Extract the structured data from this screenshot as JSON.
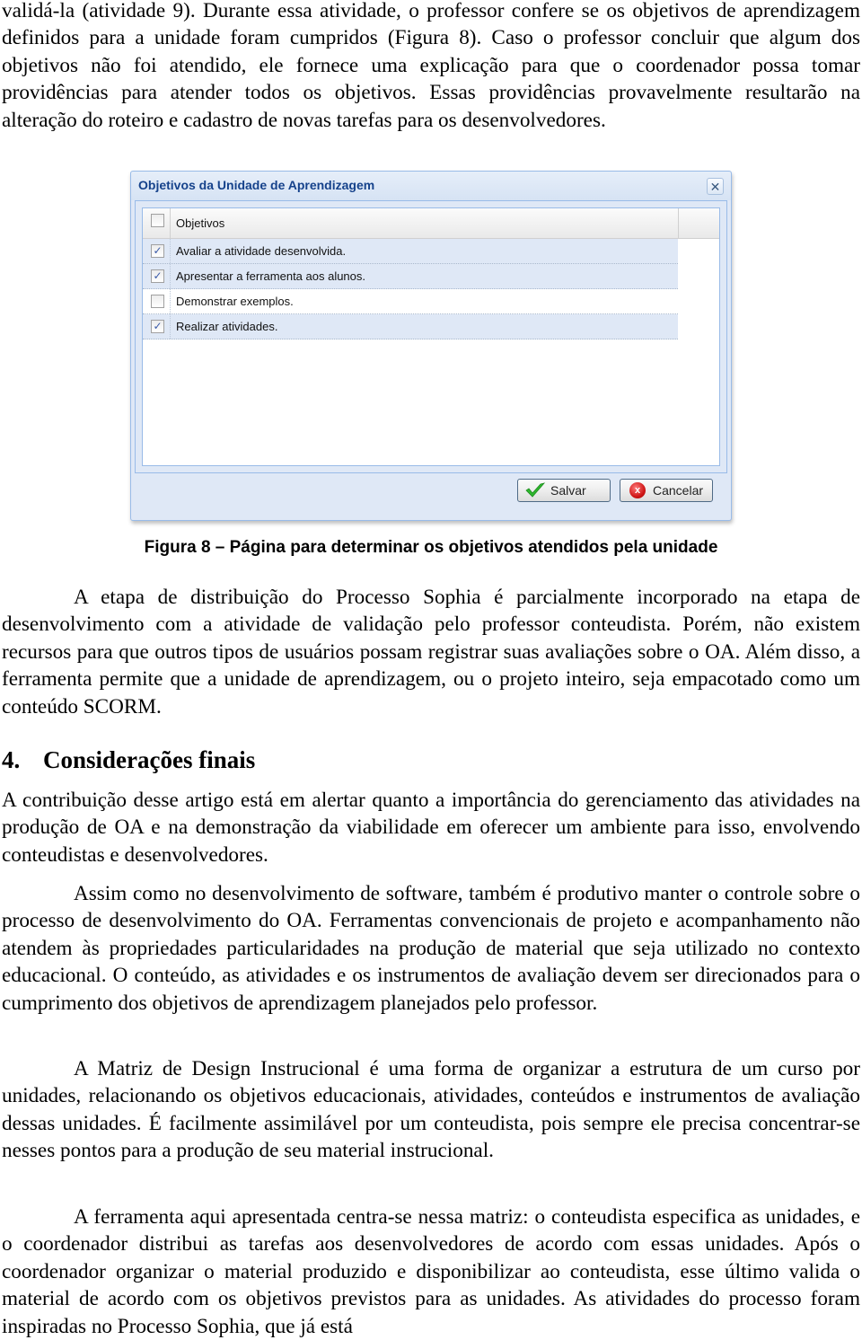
{
  "paragraphs_top": [
    "validá-la (atividade 9). Durante essa atividade, o professor confere se os objetivos de aprendizagem definidos para a unidade foram cumpridos (Figura 8). Caso o professor concluir que algum dos objetivos não foi atendido, ele fornece uma explicação para que o coordenador possa tomar providências para atender todos os objetivos. Essas providências provavelmente resultarão na alteração do roteiro e cadastro de novas tarefas para os desenvolvedores."
  ],
  "dialog": {
    "title": "Objetivos da Unidade de Aprendizagem",
    "close_icon": "close-icon",
    "column_header": "Objetivos",
    "header_checked": false,
    "rows": [
      {
        "label": "Avaliar a atividade desenvolvida.",
        "checked": true
      },
      {
        "label": "Apresentar a ferramenta aos alunos.",
        "checked": true
      },
      {
        "label": "Demonstrar exemplos.",
        "checked": false
      },
      {
        "label": "Realizar atividades.",
        "checked": true
      }
    ],
    "check_glyph": "✓",
    "buttons": {
      "save": {
        "label": "Salvar",
        "icon": "check-icon"
      },
      "cancel": {
        "label": "Cancelar",
        "icon": "cancel-x-icon"
      }
    }
  },
  "caption": "Figura 8 – Página para determinar os objetivos atendidos pela unidade",
  "paragraph_after_figure": "A etapa de distribuição do Processo Sophia é parcialmente incorporado na etapa de desenvolvimento com a atividade de validação pelo professor conteudista. Porém, não existem recursos para que outros tipos de usuários possam registrar suas avaliações sobre o OA. Além disso, a ferramenta permite que a unidade de aprendizagem, ou o projeto inteiro, seja  empacotado como um conteúdo SCORM.",
  "section": {
    "number": "4.",
    "title": "Considerações finais"
  },
  "section_paragraphs": [
    "A contribuição desse artigo está em alertar quanto a importância do gerenciamento das atividades na produção de OA e na demonstração da viabilidade em oferecer um ambiente para isso, envolvendo conteudistas e desenvolvedores.",
    "Assim como no desenvolvimento de software, também é produtivo manter o controle sobre o processo de desenvolvimento do OA. Ferramentas convencionais de projeto e acompanhamento não atendem às propriedades particularidades na produção de material que seja utilizado no contexto educacional. O conteúdo, as atividades e os instrumentos de avaliação devem ser direcionados para o cumprimento dos objetivos de aprendizagem planejados pelo professor.",
    "A Matriz de Design Instrucional é uma forma de organizar a estrutura de um curso por unidades, relacionando os objetivos educacionais, atividades, conteúdos e instrumentos de avaliação dessas unidades. É facilmente assimilável por um conteudista, pois sempre ele precisa concentrar-se nesses pontos para a produção de seu material instrucional.",
    "A ferramenta aqui apresentada centra-se nessa matriz: o conteudista especifica as unidades, e o coordenador distribui as tarefas aos desenvolvedores de acordo com essas unidades. Após o coordenador organizar o material produzido e disponibilizar ao conteudista, esse último valida o material de acordo com os objetivos previstos para as unidades. As atividades do processo foram inspiradas no Processo Sophia, que já está"
  ],
  "colors": {
    "dialog_title": "#15428b",
    "dialog_bg": "#dfe8f6",
    "dialog_border": "#99bbe8",
    "selected_row": "#dfe8f6",
    "save_check": "#2eb82e",
    "cancel_red": "#d01818"
  }
}
